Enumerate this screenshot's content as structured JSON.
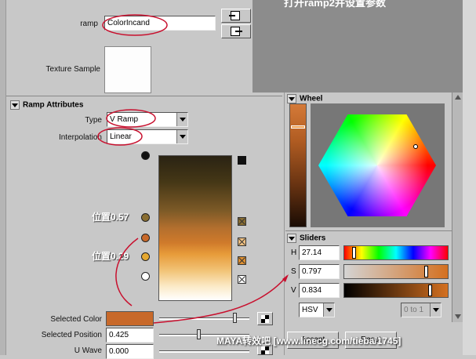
{
  "overlay_title": "打开ramp2并设置参数",
  "ramp": {
    "label": "ramp",
    "value": "ColorIncand"
  },
  "texture_sample_label": "Texture Sample",
  "ramp_attributes": {
    "header": "Ramp Attributes",
    "type_label": "Type",
    "type_value": "V Ramp",
    "interpolation_label": "Interpolation",
    "interpolation_value": "Linear"
  },
  "annotations": {
    "pos1": "位置0.57",
    "pos2": "位置0.29"
  },
  "selected_color_label": "Selected Color",
  "selected_color": "#c8692a",
  "selected_position_label": "Selected Position",
  "selected_position_value": "0.425",
  "u_wave_label": "U Wave",
  "u_wave_value": "0.000",
  "wheel": {
    "header": "Wheel"
  },
  "sliders": {
    "header": "Sliders",
    "h_label": "H",
    "h_value": "27.14",
    "s_label": "S",
    "s_value": "0.797",
    "v_label": "V",
    "v_value": "0.834",
    "mode": "HSV",
    "range": "0 to 1"
  },
  "bottom_buttons": {
    "accept": "Accept",
    "reset": "Reset"
  },
  "watermark": "MAYA转效吧  [www.linecg.com/tieba/1745]"
}
